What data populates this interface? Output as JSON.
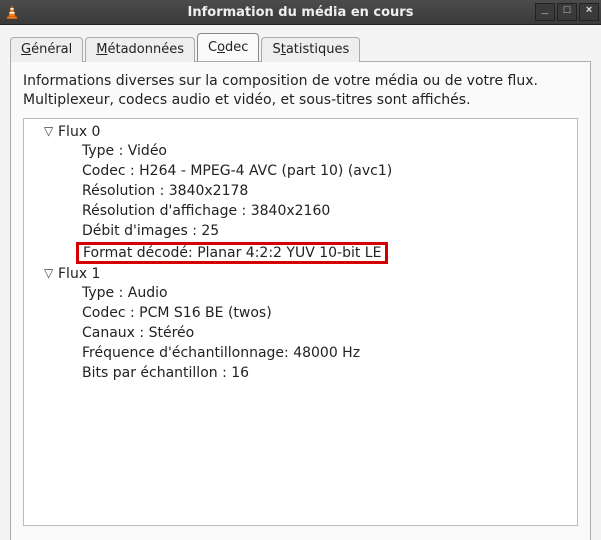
{
  "window": {
    "title": "Information du média en cours"
  },
  "tabs": [
    {
      "label": "Général",
      "hotkey_html": "<span class='underline'>G</span>énéral"
    },
    {
      "label": "Métadonnées",
      "hotkey_html": "<span class='underline'>M</span>étadonnées"
    },
    {
      "label": "Codec",
      "hotkey_html": "C<span class='underline'>o</span>dec"
    },
    {
      "label": "Statistiques",
      "hotkey_html": "S<span class='underline'>t</span>atistiques"
    }
  ],
  "active_tab_index": 2,
  "description": "Informations diverses sur la composition de votre média ou de votre flux. Multiplexeur, codecs audio et vidéo, et sous-titres sont affichés.",
  "streams": [
    {
      "name": "Flux 0",
      "expanded": true,
      "rows": [
        {
          "text": "Type : Vidéo"
        },
        {
          "text": "Codec : H264 - MPEG-4 AVC (part 10) (avc1)"
        },
        {
          "text": "Résolution : 3840x2178"
        },
        {
          "text": "Résolution d'affichage : 3840x2160"
        },
        {
          "text": "Débit d'images : 25"
        },
        {
          "text": "Format décodé: Planar 4:2:2 YUV 10-bit LE",
          "highlight": true
        }
      ]
    },
    {
      "name": "Flux 1",
      "expanded": true,
      "rows": [
        {
          "text": "Type : Audio"
        },
        {
          "text": "Codec : PCM S16 BE (twos)"
        },
        {
          "text": "Canaux : Stéréo"
        },
        {
          "text": "Fréquence d'échantillonnage: 48000 Hz"
        },
        {
          "text": "Bits par échantillon : 16"
        }
      ]
    }
  ],
  "win_controls": {
    "minimize": "_",
    "maximize": "□",
    "close": "×"
  }
}
